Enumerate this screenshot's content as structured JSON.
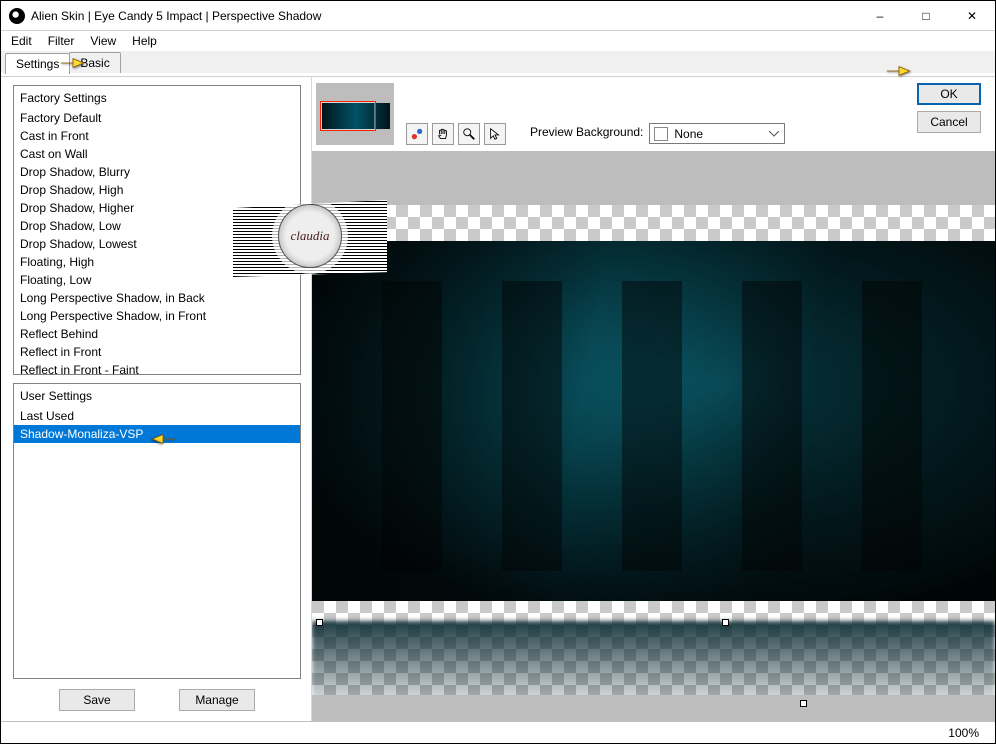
{
  "window": {
    "title": "Alien Skin | Eye Candy 5 Impact | Perspective Shadow"
  },
  "menu": {
    "items": [
      "Edit",
      "Filter",
      "View",
      "Help"
    ]
  },
  "tabs": {
    "items": [
      "Settings",
      "Basic"
    ],
    "active": 0
  },
  "factory": {
    "header": "Factory Settings",
    "items": [
      "Factory Default",
      "Cast in Front",
      "Cast on Wall",
      "Drop Shadow, Blurry",
      "Drop Shadow, High",
      "Drop Shadow, Higher",
      "Drop Shadow, Low",
      "Drop Shadow, Lowest",
      "Floating, High",
      "Floating, Low",
      "Long Perspective Shadow, in Back",
      "Long Perspective Shadow, in Front",
      "Reflect Behind",
      "Reflect in Front",
      "Reflect in Front - Faint"
    ]
  },
  "user": {
    "header": "User Settings",
    "items": [
      "Last Used",
      "Shadow-Monaliza-VSP"
    ],
    "selected": 1
  },
  "buttons": {
    "save": "Save",
    "manage": "Manage",
    "ok": "OK",
    "cancel": "Cancel"
  },
  "previewbg": {
    "label": "Preview Background:",
    "value": "None"
  },
  "status": {
    "zoom": "100%"
  },
  "stamp": {
    "text": "claudia"
  }
}
